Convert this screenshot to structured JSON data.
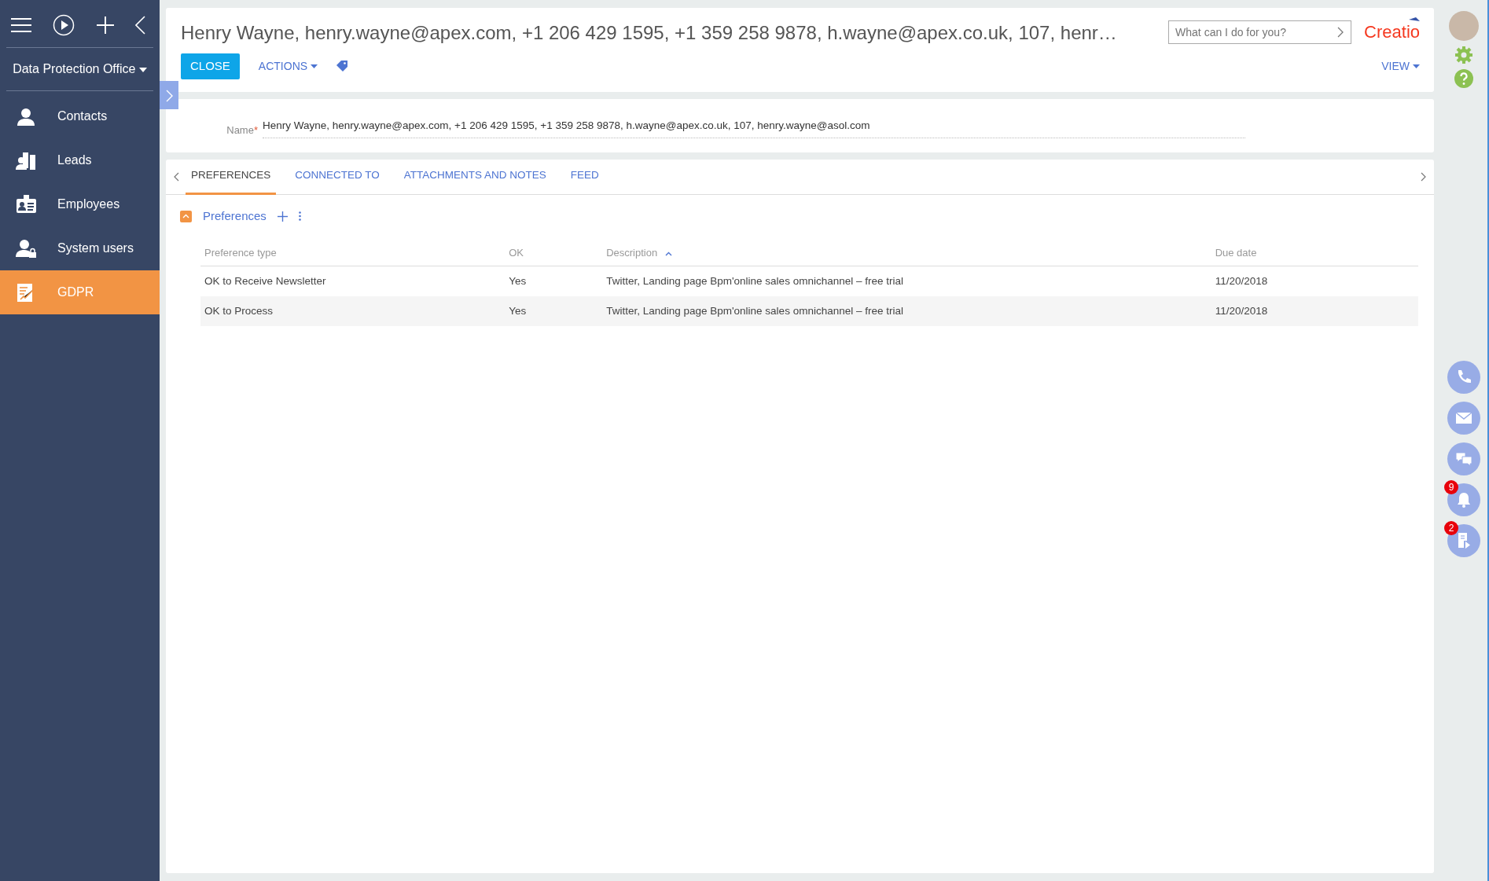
{
  "sidebar": {
    "workplace": "Data Protection Office",
    "items": [
      {
        "label": "Contacts",
        "kind": "contact",
        "selected": false
      },
      {
        "label": "Leads",
        "kind": "lead",
        "selected": false
      },
      {
        "label": "Employees",
        "kind": "employee",
        "selected": false
      },
      {
        "label": "System users",
        "kind": "user",
        "selected": false
      },
      {
        "label": "GDPR",
        "kind": "gdpr",
        "selected": true
      }
    ]
  },
  "header": {
    "title": "Henry Wayne, henry.wayne@apex.com, +1 206 429 1595, +1 359 258 9878, h.wayne@apex.co.uk, 107, henr…",
    "close_button": "CLOSE",
    "actions_button": "ACTIONS",
    "view_button": "VIEW",
    "search": {
      "placeholder": "What can I do for you?"
    },
    "logo": "Creatio"
  },
  "name_field": {
    "label": "Name",
    "required_mark": "*",
    "value": "Henry Wayne, henry.wayne@apex.com, +1 206 429 1595, +1 359 258 9878, h.wayne@apex.co.uk, 107, henry.wayne@asol.com"
  },
  "tabs": [
    {
      "label": "PREFERENCES",
      "selected": true
    },
    {
      "label": "CONNECTED TO",
      "selected": false
    },
    {
      "label": "ATTACHMENTS AND NOTES",
      "selected": false
    },
    {
      "label": "FEED",
      "selected": false
    }
  ],
  "detail": {
    "title": "Preferences",
    "expanded": true,
    "table": {
      "columns": [
        {
          "label": "Preference type",
          "sorted": false
        },
        {
          "label": "OK",
          "sorted": false
        },
        {
          "label": "Description",
          "sorted": true
        },
        {
          "label": "Due date",
          "sorted": false
        }
      ],
      "rows": [
        [
          "OK to Receive Newsletter",
          "Yes",
          "Twitter, Landing page Bpm'online sales omnichannel – free trial",
          "11/20/2018"
        ],
        [
          "OK to Process",
          "Yes",
          "Twitter, Landing page Bpm'online sales omnichannel – free trial",
          "11/20/2018"
        ]
      ]
    }
  },
  "right_bar": [
    {
      "kind": "phone"
    },
    {
      "kind": "email"
    },
    {
      "kind": "chat"
    },
    {
      "kind": "bell",
      "badge": "9"
    },
    {
      "kind": "feed",
      "badge": "2"
    }
  ]
}
